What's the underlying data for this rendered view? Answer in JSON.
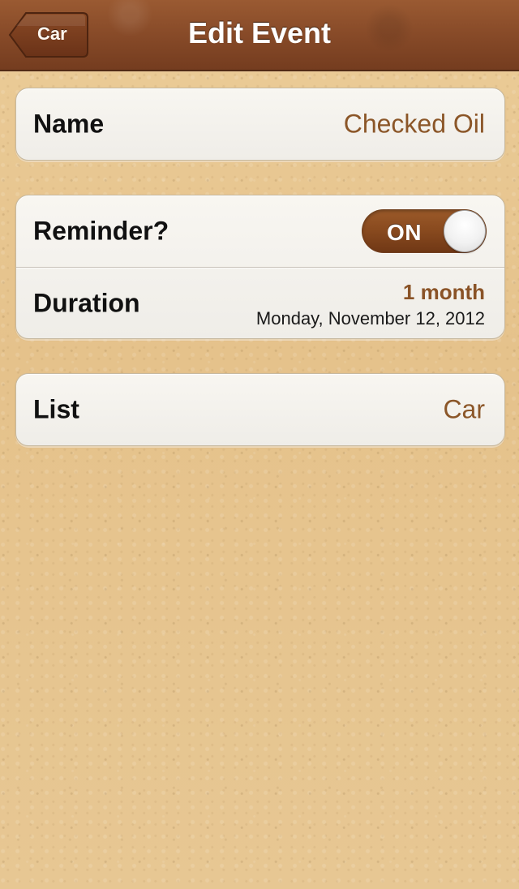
{
  "navbar": {
    "back_label": "Car",
    "title": "Edit Event"
  },
  "form": {
    "name": {
      "label": "Name",
      "value": "Checked Oil"
    },
    "reminder": {
      "label": "Reminder?",
      "toggle_state": "ON"
    },
    "duration": {
      "label": "Duration",
      "value": "1 month",
      "date": "Monday, November 12, 2012"
    },
    "list": {
      "label": "List",
      "value": "Car"
    }
  },
  "colors": {
    "navbar_top": "#9a5a32",
    "navbar_bottom": "#743c1f",
    "accent_text": "#8b5628",
    "background": "#e6c68f",
    "card_background": "#f3f1ec"
  },
  "icons": {
    "back_button_icon": "back-arrow-icon"
  }
}
